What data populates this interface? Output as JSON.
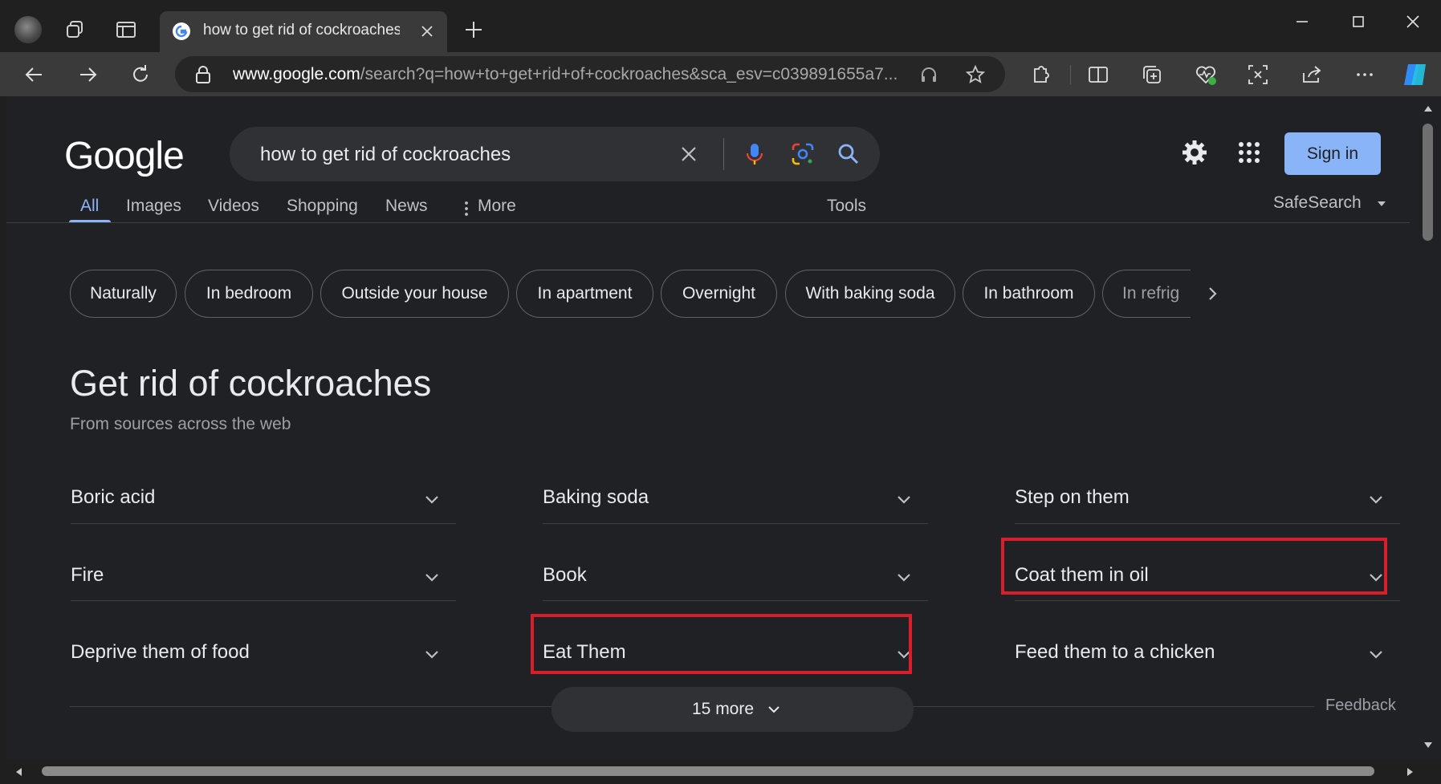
{
  "browser": {
    "tab_title": "how to get rid of cockroaches - Google Search",
    "url_host": "www.google.com",
    "url_path": "/search?q=how+to+get+rid+of+cockroaches&sca_esv=c039891655a7..."
  },
  "google": {
    "logo": "Google",
    "query": "how to get rid of cockroaches",
    "sign_in": "Sign in",
    "nav_tabs": [
      "All",
      "Images",
      "Videos",
      "Shopping",
      "News",
      "More"
    ],
    "tools": "Tools",
    "safesearch": "SafeSearch",
    "chips": [
      "Naturally",
      "In bedroom",
      "Outside your house",
      "In apartment",
      "Overnight",
      "With baking soda",
      "In bathroom",
      "In refrig"
    ],
    "section_title": "Get rid of cockroaches",
    "section_subtitle": "From sources across the web",
    "items": [
      "Boric acid",
      "Baking soda",
      "Step on them",
      "Fire",
      "Book",
      "Coat them in oil",
      "Deprive them of food",
      "Eat Them",
      "Feed them to a chicken"
    ],
    "more_label": "15 more",
    "feedback": "Feedback"
  },
  "colors": {
    "accent_blue": "#8ab4f8",
    "highlight_red": "#d81e2a"
  }
}
